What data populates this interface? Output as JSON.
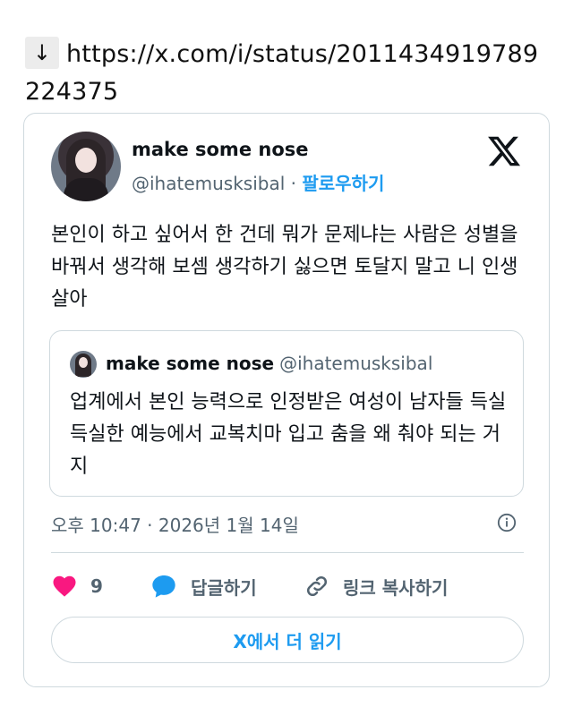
{
  "header": {
    "arrow": "↓",
    "url": "https://x.com/i/status/2011434919789224375"
  },
  "tweet": {
    "author_name": "make some nose",
    "author_handle": "@ihatemusksibal",
    "separator": "·",
    "follow_label": "팔로우하기",
    "text": "본인이 하고 싶어서 한 건데 뭐가 문제냐는 사람은 성별을 바꿔서 생각해 보셈 생각하기 싫으면 토달지 말고 니 인생 살아",
    "timestamp": "오후 10:47 · 2026년 1월 14일",
    "quote": {
      "author_name": "make some nose",
      "author_handle": "@ihatemusksibal",
      "text": "업계에서 본인 능력으로 인정받은 여성이 남자들 득실득실한 예능에서 교복치마 입고 춤을 왜 춰야 되는 거지"
    },
    "actions": {
      "like_count": "9",
      "reply_label": "답글하기",
      "copy_link_label": "링크 복사하기"
    },
    "read_more_label": "X에서 더 읽기"
  },
  "colors": {
    "accent": "#1d9bf0",
    "like": "#f91880",
    "muted": "#536471",
    "border": "#cfd9de"
  },
  "icons": {
    "logo": "x-logo-icon",
    "info": "info-icon",
    "like": "heart-icon",
    "reply": "speech-bubble-icon",
    "copy": "link-icon"
  }
}
